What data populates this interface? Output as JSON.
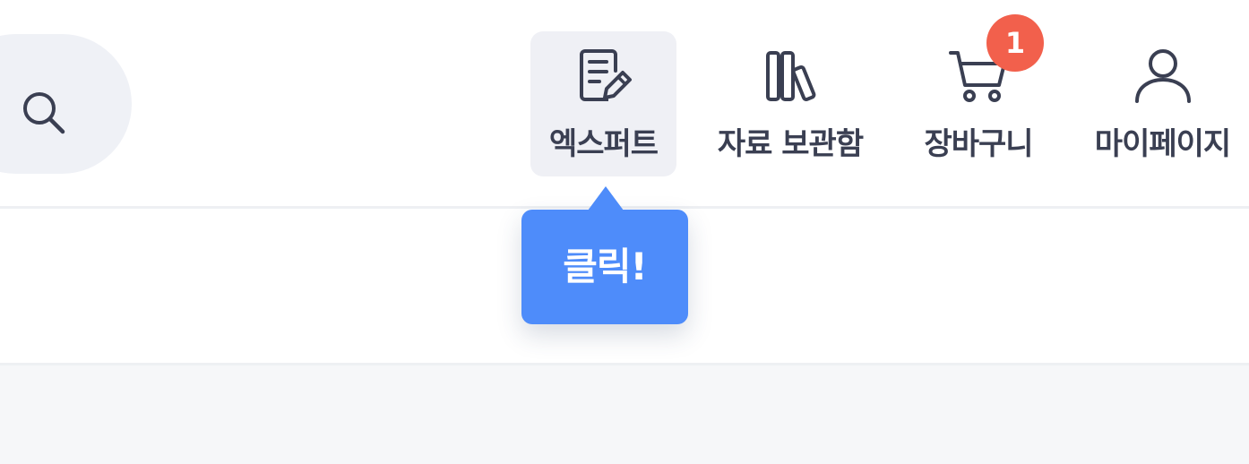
{
  "header": {
    "search": {
      "icon": "search-icon"
    },
    "nav": {
      "expert": {
        "label": "엑스퍼트",
        "icon": "document-edit-icon"
      },
      "library": {
        "label": "자료 보관함",
        "icon": "books-icon"
      },
      "cart": {
        "label": "장바구니",
        "icon": "cart-icon",
        "badge": "1"
      },
      "mypage": {
        "label": "마이페이지",
        "icon": "user-icon"
      }
    }
  },
  "tooltip": {
    "text": "클릭!"
  },
  "colors": {
    "tooltip_bg": "#4e8cfa",
    "badge_bg": "#f2604c",
    "active_nav_bg": "#eff0f5",
    "label_text": "#3a3f52"
  }
}
